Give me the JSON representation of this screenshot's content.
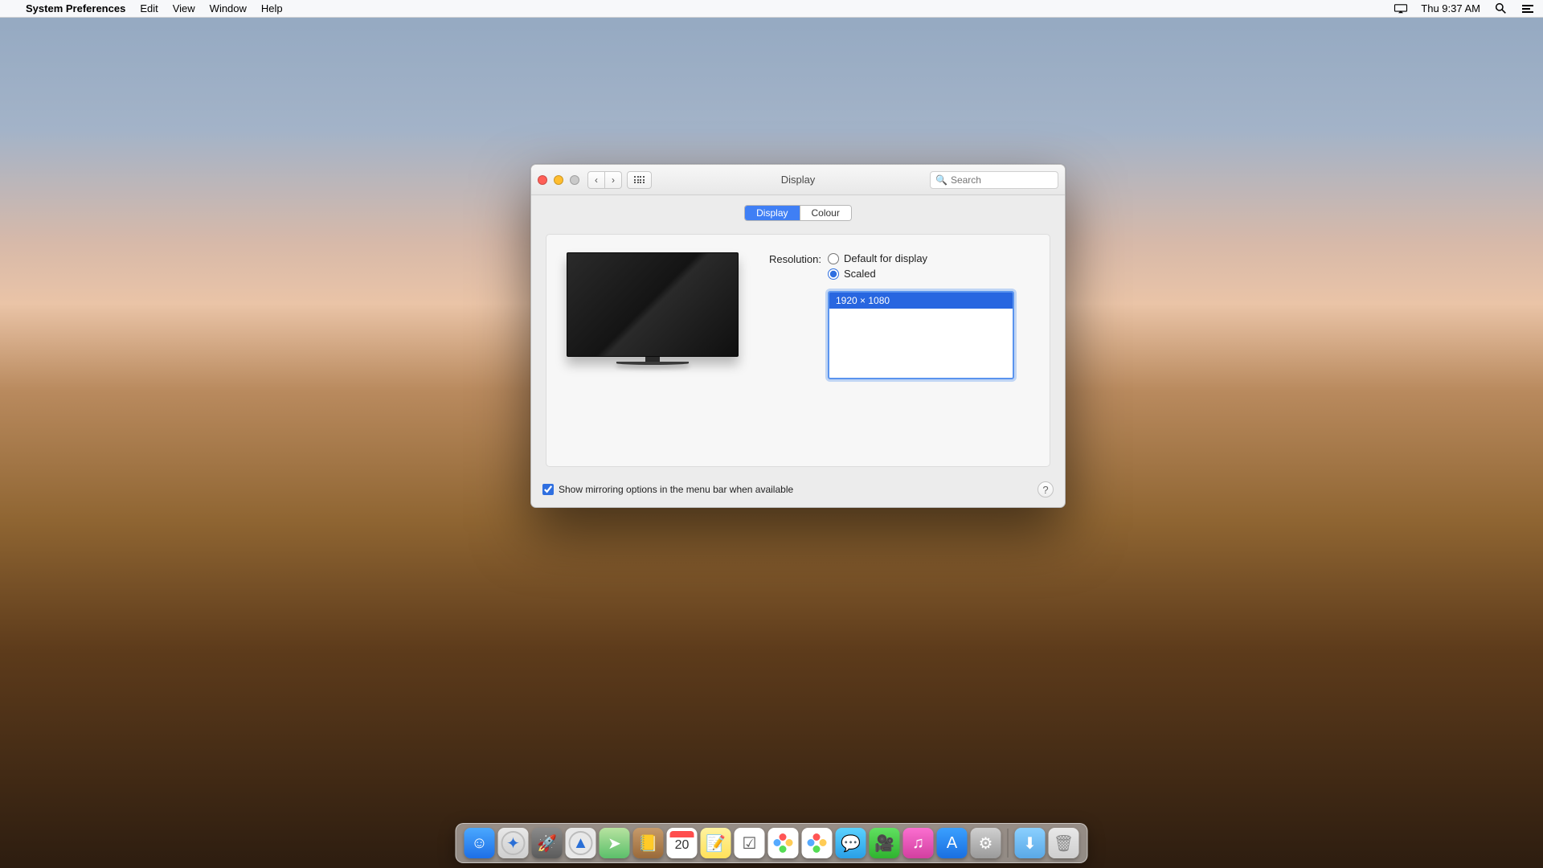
{
  "menubar": {
    "app_name": "System Preferences",
    "items": [
      "Edit",
      "View",
      "Window",
      "Help"
    ],
    "clock": "Thu 9:37 AM"
  },
  "window": {
    "title": "Display",
    "search_placeholder": "Search",
    "tabs": {
      "display": "Display",
      "colour": "Colour"
    },
    "resolution_label": "Resolution:",
    "radio_default": "Default for display",
    "radio_scaled": "Scaled",
    "resolutions": [
      "1920 × 1080"
    ],
    "mirroring_label": "Show mirroring options in the menu bar when available",
    "help_label": "?"
  },
  "dock": {
    "calendar_day": "20"
  }
}
